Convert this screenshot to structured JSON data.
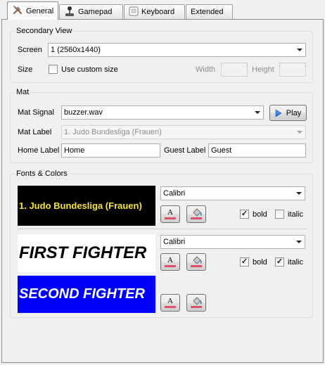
{
  "tabs": [
    {
      "label": "General",
      "icon": "tools-icon",
      "active": true
    },
    {
      "label": "Gamepad",
      "icon": "joystick-icon"
    },
    {
      "label": "Keyboard",
      "icon": "keyboard-icon"
    },
    {
      "label": "Extended"
    }
  ],
  "secondary_view": {
    "title": "Secondary View",
    "screen_label": "Screen",
    "screen_value": "1 (2560x1440)",
    "size_label": "Size",
    "custom_size_label": "Use custom size",
    "custom_size_checked": false,
    "width_label": "Width",
    "width_value": "",
    "height_label": "Height",
    "height_value": ""
  },
  "mat": {
    "title": "Mat",
    "signal_label": "Mat Signal",
    "signal_value": "buzzer.wav",
    "play_label": "Play",
    "mat_label_label": "Mat Label",
    "mat_label_value": "1. Judo Bundesliga (Frauen)",
    "home_label_label": "Home Label",
    "home_label_value": "Home",
    "guest_label_label": "Guest Label",
    "guest_label_value": "Guest"
  },
  "fonts_colors": {
    "title": "Fonts & Colors",
    "text_color_button": "A",
    "bold_label": "bold",
    "italic_label": "italic",
    "header": {
      "preview_text": "1. Judo Bundesliga (Frauen)",
      "font": "Calibri",
      "bold": true,
      "italic": false,
      "bg_color": "#000000",
      "text_color": "#f5e23a"
    },
    "first_fighter": {
      "preview_text": "FIRST FIGHTER",
      "font": "Calibri",
      "bold": true,
      "italic": true,
      "bg_color": "#ffffff",
      "text_color": "#000000"
    },
    "second_fighter": {
      "preview_text": "SECOND FIGHTER",
      "bg_color": "#0000ff",
      "text_color": "#ffffff"
    }
  }
}
